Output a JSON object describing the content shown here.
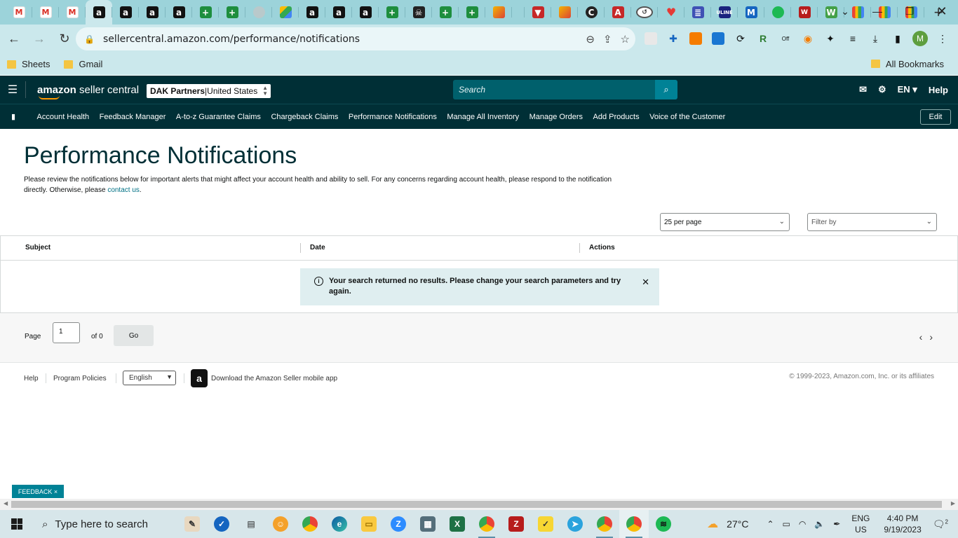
{
  "browser": {
    "tabs": [
      {
        "icon": "gmail-icon",
        "glyph": "M",
        "cls": "gmail"
      },
      {
        "icon": "gmail-icon",
        "glyph": "M",
        "cls": "gmail"
      },
      {
        "icon": "gmail-icon",
        "glyph": "M",
        "cls": "gmail"
      },
      {
        "icon": "amazon-icon",
        "glyph": "a",
        "cls": "amz",
        "active": true
      },
      {
        "icon": "amazon-icon",
        "glyph": "a",
        "cls": "amz"
      },
      {
        "icon": "amazon-icon",
        "glyph": "a",
        "cls": "amz"
      },
      {
        "icon": "amazon-icon",
        "glyph": "a",
        "cls": "amz"
      },
      {
        "icon": "sheets-icon",
        "glyph": "+",
        "cls": "sheet"
      },
      {
        "icon": "sheets-icon",
        "glyph": "+",
        "cls": "sheet"
      },
      {
        "icon": "grey-circle-icon",
        "glyph": "",
        "cls": "grey"
      },
      {
        "icon": "drive-icon",
        "glyph": "",
        "cls": "drive"
      },
      {
        "icon": "amazon-icon",
        "glyph": "a",
        "cls": "amz"
      },
      {
        "icon": "amazon-icon",
        "glyph": "a",
        "cls": "amz"
      },
      {
        "icon": "amazon-icon",
        "glyph": "a",
        "cls": "amz"
      },
      {
        "icon": "sheets-icon",
        "glyph": "+",
        "cls": "sheet"
      },
      {
        "icon": "pirate-icon",
        "glyph": "☠",
        "cls": "pirate"
      },
      {
        "icon": "sheets-icon",
        "glyph": "+",
        "cls": "sheet"
      },
      {
        "icon": "sheets-icon",
        "glyph": "+",
        "cls": "sheet"
      },
      {
        "icon": "pencil-icon",
        "glyph": "",
        "cls": "pencil"
      },
      {
        "icon": "blank-icon",
        "glyph": "",
        "cls": ""
      },
      {
        "icon": "red-shield-icon",
        "glyph": "▼",
        "cls": "red"
      },
      {
        "icon": "pencil-icon",
        "glyph": "",
        "cls": "pencil"
      },
      {
        "icon": "c-circle-icon",
        "glyph": "C",
        "cls": "cc"
      },
      {
        "icon": "red-shield-icon",
        "glyph": "A",
        "cls": "red"
      },
      {
        "icon": "history-icon",
        "glyph": "↺",
        "cls": "clock"
      },
      {
        "icon": "heart-icon",
        "glyph": "♥",
        "cls": "heart"
      },
      {
        "icon": "list-icon",
        "glyph": "≣",
        "cls": "list"
      },
      {
        "icon": "uline-icon",
        "glyph": "ULINE",
        "cls": "uline"
      },
      {
        "icon": "m-icon",
        "glyph": "M",
        "cls": "mm"
      },
      {
        "icon": "leaf-icon",
        "glyph": "",
        "cls": "spot"
      },
      {
        "icon": "vw-icon",
        "glyph": "W",
        "cls": "vw"
      },
      {
        "icon": "w-icon",
        "glyph": "W",
        "cls": "w"
      },
      {
        "icon": "colorful-grid-icon",
        "glyph": "",
        "cls": "multi"
      },
      {
        "icon": "colorful-grid-icon",
        "glyph": "",
        "cls": "multi"
      },
      {
        "icon": "colorful-grid-icon",
        "glyph": "",
        "cls": "multi"
      }
    ],
    "new_tab": "+",
    "url": "sellercentral.amazon.com/performance/notifications",
    "bookmarks": [
      {
        "label": "Sheets"
      },
      {
        "label": "Gmail"
      }
    ],
    "all_bookmarks": "All Bookmarks",
    "profile_initial": "M",
    "off_badge": "Off"
  },
  "seller": {
    "logo_bold": "amazon",
    "logo_rest": " seller central",
    "account_name": "DAK Partners",
    "account_sep": " | ",
    "account_region": "United States",
    "search_placeholder": "Search",
    "lang": "EN ▾",
    "help": "Help",
    "nav": [
      "Account Health",
      "Feedback Manager",
      "A-to-z Guarantee Claims",
      "Chargeback Claims",
      "Performance Notifications",
      "Manage All Inventory",
      "Manage Orders",
      "Add Products",
      "Voice of the Customer"
    ],
    "edit": "Edit"
  },
  "page": {
    "title": "Performance Notifications",
    "intro_text": "Please review the notifications below for important alerts that might affect your account health and ability to sell. For any concerns regarding account health, please respond to the notification directly. Otherwise, please ",
    "intro_link": "contact us",
    "intro_end": ".",
    "per_page": "25 per page",
    "filter": "Filter by",
    "columns": [
      "Subject",
      "Date",
      "Actions"
    ],
    "alert": "Your search returned no results. Please change your search parameters and try again.",
    "pager": {
      "page_label": "Page",
      "page_value": "1",
      "of_label": "of 0",
      "go": "Go"
    }
  },
  "footer": {
    "help": "Help",
    "policies": "Program Policies",
    "language": "English",
    "download": "Download the Amazon Seller mobile app",
    "copyright": "© 1999-2023, Amazon.com, Inc. or its affiliates"
  },
  "feedback": "FEEDBACK ×",
  "taskbar": {
    "search_placeholder": "Type here to search",
    "temperature": "27°C",
    "lang_top": "ENG",
    "lang_bottom": "US",
    "time": "4:40 PM",
    "date": "9/19/2023",
    "notif_count": "2"
  }
}
